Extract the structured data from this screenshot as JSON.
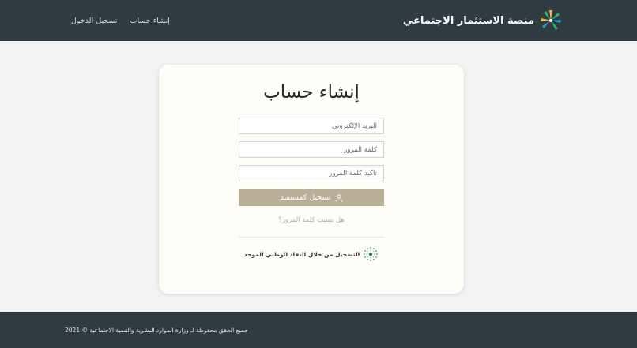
{
  "header": {
    "brand_title": "منصة الاستثمار الاجتماعي",
    "logo_icon": "palm-leaf-icon",
    "nav": {
      "register": "إنشاء حساب",
      "login": "تسجيل الدخول"
    }
  },
  "card": {
    "title": "إنشاء حساب",
    "email_placeholder": "البريد الإلكتروني",
    "password_placeholder": "كلمة المرور",
    "confirm_placeholder": "تأكيد كلمة المرور",
    "submit_label": "تسجيل كمستفيد",
    "submit_icon": "user-icon",
    "forgot_label": "هل نسيت كلمة المرور؟",
    "nafath_label": "التسجيل من خلال النفاذ الوطني الموحد",
    "nafath_icon": "nafath-logo-icon"
  },
  "footer": {
    "copyright": "جميع الحقق محفوظة لـ وزارة الموارد البشرية والتنمية الاجتماعية © 2021"
  },
  "colors": {
    "header_bg": "#2f3b40",
    "page_bg": "#f3f3f3",
    "card_bg": "#fffdf7",
    "button_bg": "#bbae99",
    "link": "#9fb3c6"
  }
}
